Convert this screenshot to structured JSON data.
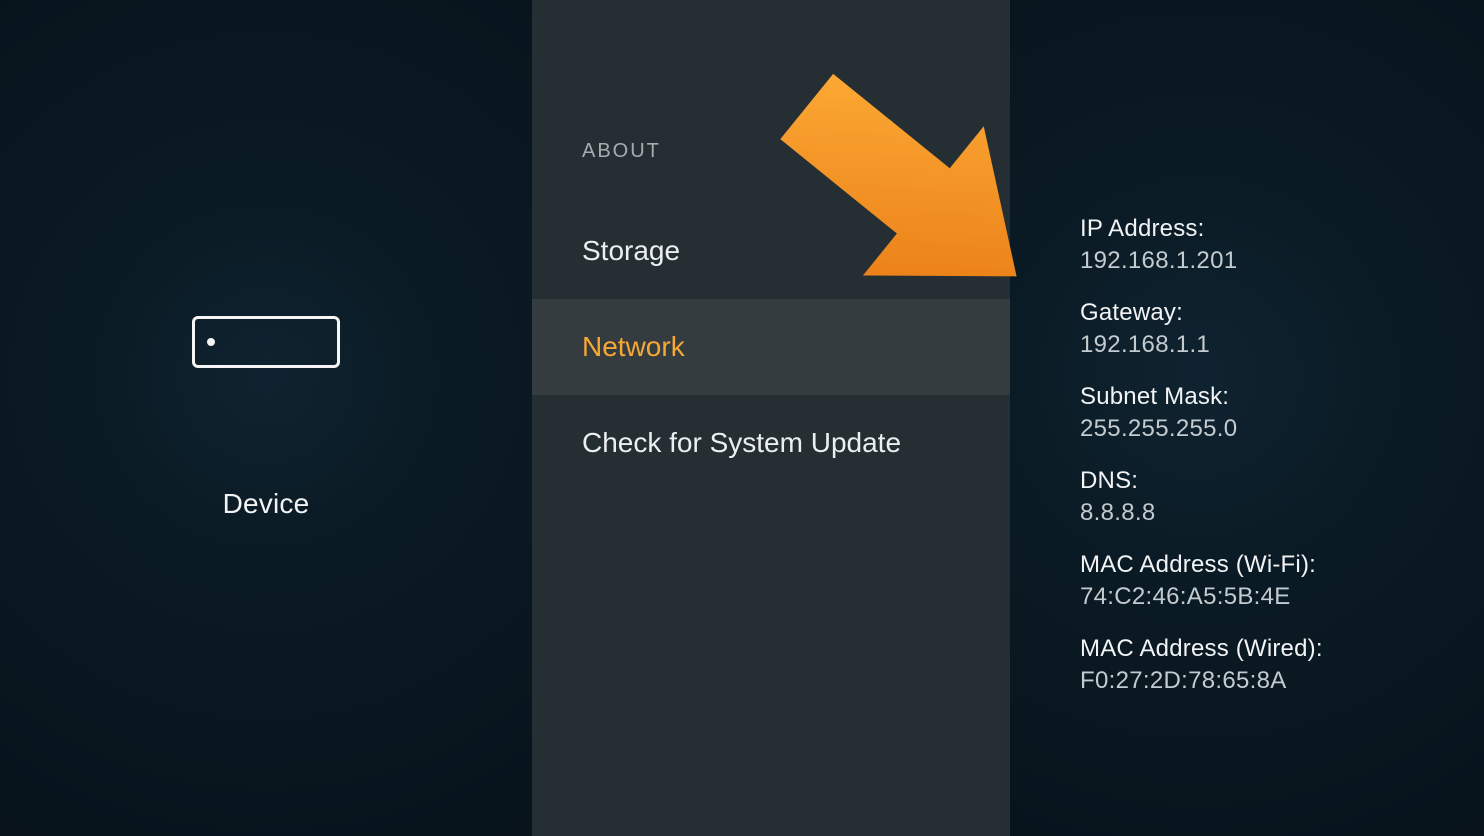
{
  "left": {
    "device_label": "Device"
  },
  "middle": {
    "heading": "ABOUT",
    "items": [
      {
        "label": "Storage",
        "selected": false
      },
      {
        "label": "Network",
        "selected": true
      },
      {
        "label": "Check for System Update",
        "selected": false
      }
    ]
  },
  "right": {
    "details": [
      {
        "label": "IP Address:",
        "value": "192.168.1.201"
      },
      {
        "label": "Gateway:",
        "value": "192.168.1.1"
      },
      {
        "label": "Subnet Mask:",
        "value": "255.255.255.0"
      },
      {
        "label": "DNS:",
        "value": "8.8.8.8"
      },
      {
        "label": "MAC Address (Wi-Fi):",
        "value": "74:C2:46:A5:5B:4E"
      },
      {
        "label": "MAC Address (Wired):",
        "value": "F0:27:2D:78:65:8A"
      }
    ]
  },
  "annotation": {
    "arrow_color_start": "#ffb03a",
    "arrow_color_end": "#e67510"
  }
}
